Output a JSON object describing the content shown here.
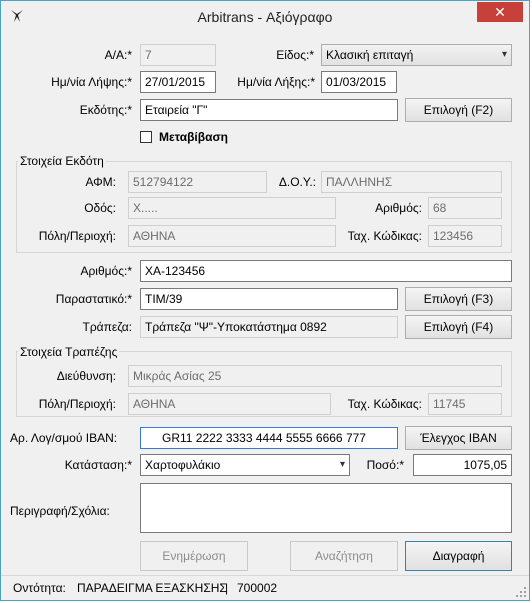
{
  "window": {
    "title": "Arbitrans - Αξιόγραφο",
    "close_glyph": "✕"
  },
  "form": {
    "aa_label": "Α/Α:*",
    "aa_value": "7",
    "type_label": "Είδος:*",
    "type_value": "Κλασική επιταγή",
    "recv_date_label": "Ημ/νία Λήψης:*",
    "recv_date_value": "27/01/2015",
    "due_date_label": "Ημ/νία Λήξης:*",
    "due_date_value": "01/03/2015",
    "issuer_label": "Εκδότης:*",
    "issuer_value": "Εταιρεία \"Γ\"",
    "issuer_button": "Επιλογή (F2)",
    "transfer_label": "Μεταβίβαση",
    "issuer_group": {
      "title": "Στοιχεία Εκδότη",
      "afm_label": "ΑΦΜ:",
      "afm_value": "512794122",
      "doy_label": "Δ.Ο.Υ.:",
      "doy_value": "ΠΑΛΛΗΝΗΣ",
      "street_label": "Οδός:",
      "street_value": "Χ.....",
      "number_label": "Αριθμός:",
      "number_value": "68",
      "city_label": "Πόλη/Περιοχή:",
      "city_value": "ΑΘΗΝΑ",
      "zip_label": "Ταχ. Κώδικας:",
      "zip_value": "123456"
    },
    "doc_number_label": "Αριθμός:*",
    "doc_number_value": "ΧΑ-123456",
    "voucher_label": "Παραστατικό:*",
    "voucher_value": "ΤΙΜ/39",
    "voucher_button": "Επιλογή (F3)",
    "bank_label": "Τράπεζα:",
    "bank_value": "Τράπεζα \"Ψ\"-Υποκατάστημα 0892",
    "bank_button": "Επιλογή (F4)",
    "bank_group": {
      "title": "Στοιχεία Τραπέζης",
      "address_label": "Διεύθυνση:",
      "address_value": "Μικράς Ασίας 25",
      "city_label": "Πόλη/Περιοχή:",
      "city_value": "ΑΘΗΝΑ",
      "zip_label": "Ταχ. Κώδικας:",
      "zip_value": "11745"
    },
    "iban_label": "Αρ. Λογ/σμού IBAN:",
    "iban_value": "GR11 2222 3333 4444 5555 6666 777",
    "iban_button": "Έλεγχος IBAN",
    "status_label": "Κατάσταση:*",
    "status_value": "Χαρτοφυλάκιο",
    "amount_label": "Ποσό:*",
    "amount_value": "1075,05",
    "notes_label": "Περιγραφή/Σχόλια:",
    "notes_value": ""
  },
  "buttons": {
    "update": "Ενημέρωση",
    "search": "Αναζήτηση",
    "delete": "Διαγραφή"
  },
  "statusbar": {
    "entity_label": "Οντότητα:",
    "entity_value": "ΠΑΡΑΔΕΙΓΜΑ ΕΞΑΣΚΗΣΗΣ",
    "separator": "|",
    "code": "700002"
  }
}
